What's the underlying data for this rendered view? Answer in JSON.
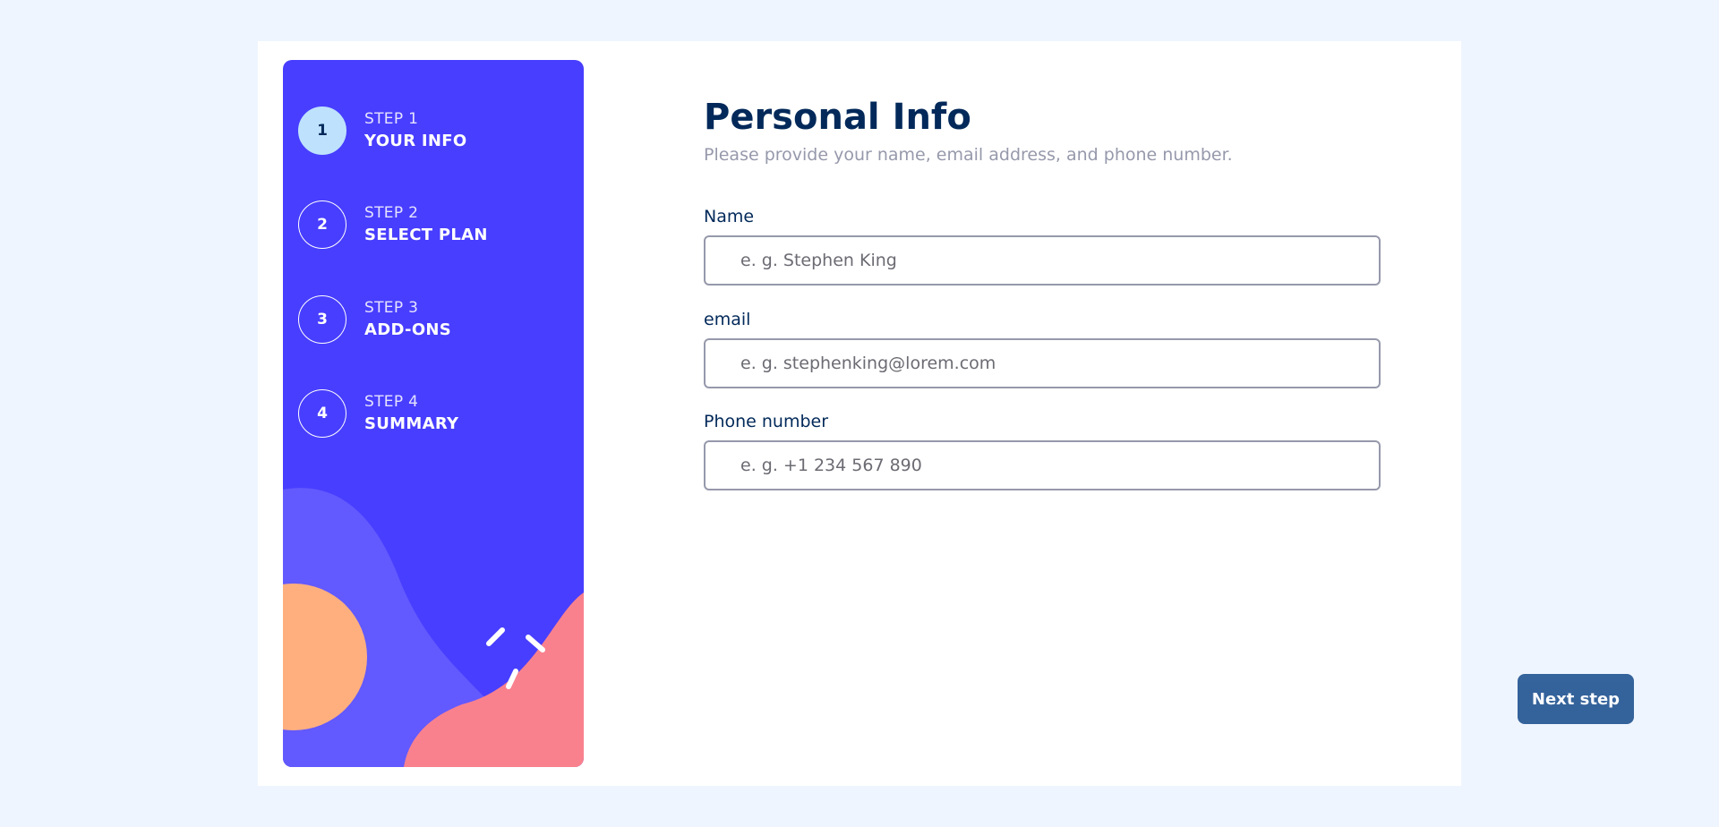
{
  "sidebar": {
    "steps": [
      {
        "number": "1",
        "label": "STEP 1",
        "title": "YOUR INFO",
        "active": true
      },
      {
        "number": "2",
        "label": "STEP 2",
        "title": "SELECT PLAN",
        "active": false
      },
      {
        "number": "3",
        "label": "STEP 3",
        "title": "ADD-ONS",
        "active": false
      },
      {
        "number": "4",
        "label": "STEP 4",
        "title": "SUMMARY",
        "active": false
      }
    ]
  },
  "form": {
    "title": "Personal Info",
    "subtitle": "Please provide your name, email address, and phone number.",
    "name": {
      "label": "Name",
      "placeholder": "e. g. Stephen King",
      "value": ""
    },
    "email": {
      "label": "email",
      "placeholder": "e. g. stephenking@lorem.com",
      "value": ""
    },
    "phone": {
      "label": "Phone number",
      "placeholder": "e. g. +1 234 567 890",
      "value": ""
    },
    "next_label": "Next step"
  },
  "colors": {
    "sidebar_bg": "#483eff",
    "active_step": "#bee2fd",
    "title": "#02295a",
    "muted": "#9699ab",
    "button": "#164a8a",
    "blob_violet": "#6259ff",
    "blob_orange": "#ffaf7e",
    "blob_pink": "#f9818e"
  }
}
